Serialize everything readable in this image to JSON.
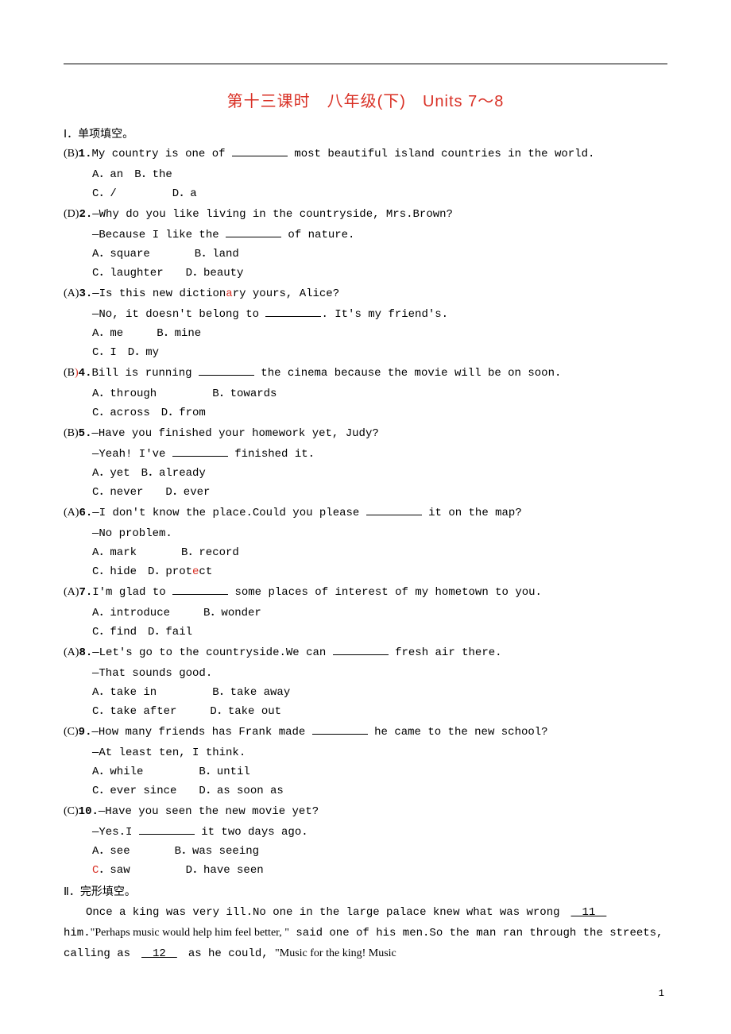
{
  "title": "第十三课时　八年级(下)　Units 7～8",
  "sectionI": "Ⅰ．单项填空。",
  "q1": {
    "ans": "(B)",
    "num": "1.",
    "stem_a": "My country is one of ",
    "stem_b": " most beautiful island countries in the world.",
    "opt1": "A．an　B．the",
    "opt2": "C．/　　　　　D．a"
  },
  "q2": {
    "ans": "(D)",
    "num": "2.",
    "stem": "—Why do you like living in the countryside, Mrs.Brown?",
    "line2a": "—Because I like the ",
    "line2b": " of nature.",
    "opt1": "A．square　　　　B．land",
    "opt2": "C．laughter　　D．beauty"
  },
  "q3": {
    "ans": "(A)",
    "num": "3.",
    "stem": "—Is this new dictionary yours, Alice?",
    "line2a": "—No, it doesn't belong to ",
    "line2b": ". It's my friend's.",
    "opt1": "A．me　　　B．mine",
    "opt2": "C．I　D．my"
  },
  "q4": {
    "ans": "(B)",
    "num": "4.",
    "stem_a": "Bill is running ",
    "stem_b": " the cinema because the movie will be on soon.",
    "opt1": "A．through　　　　　B．towards",
    "opt2": "C．across　D．from"
  },
  "q5": {
    "ans": "(B)",
    "num": "5.",
    "stem": "—Have you finished your homework yet, Judy?",
    "line2a": "—Yeah! I've ",
    "line2b": " finished it.",
    "opt1": "A．yet　B．already",
    "opt2": "C．never　　D．ever"
  },
  "q6": {
    "ans": "(A)",
    "num": "6.",
    "stem_a": "—I don't know the place.Could you please ",
    "stem_b": " it on the map?",
    "line2": "—No problem.",
    "opt1": "A．mark　　　　B．record",
    "opt2": "C．hide　D．protect"
  },
  "q7": {
    "ans": "(A)",
    "num": "7.",
    "stem_a": "I'm glad to ",
    "stem_b": " some places of interest of my hometown to you.",
    "opt1": "A．introduce　　　B．wonder",
    "opt2": "C．find　D．fail"
  },
  "q8": {
    "ans": "(A)",
    "num": "8.",
    "stem_a": "—Let's go to the countryside.We can ",
    "stem_b": " fresh air there.",
    "line2": "—That sounds good.",
    "opt1": "A．take in　　　　　B．take away",
    "opt2": "C．take after　　　D．take out"
  },
  "q9": {
    "ans": "(C)",
    "num": "9.",
    "stem_a": "—How many friends has Frank made ",
    "stem_b": " he came to the new school?",
    "line2": "—At least ten, I think.",
    "opt1": "A．while　　　　　B．until",
    "opt2": "C．ever since　　D．as soon as"
  },
  "q10": {
    "ans": "(C)",
    "num": "10.",
    "stem": "—Have you seen the new movie yet?",
    "line2a": "—Yes.I ",
    "line2b": " it two days ago.",
    "opt1": "A．see　　　　B．was seeing",
    "opt2": "C．saw　　　　　D．have seen"
  },
  "sectionII": "Ⅱ．完形填空。",
  "cloze_p1_a": "Once a king was very ill.No one in the large palace knew what was wrong　",
  "cloze_blank11": "　11　",
  "cloze_p1_b": "him.",
  "cloze_p1_c": "\"Perhaps music would help him feel better, \"",
  "cloze_p1_d": " said one of his men.So the man ran through the streets, calling as　",
  "cloze_blank12": "　12　",
  "cloze_p1_e": "　as he could, ",
  "cloze_p1_f": "\"Music for the king! Music",
  "page_num": "1"
}
